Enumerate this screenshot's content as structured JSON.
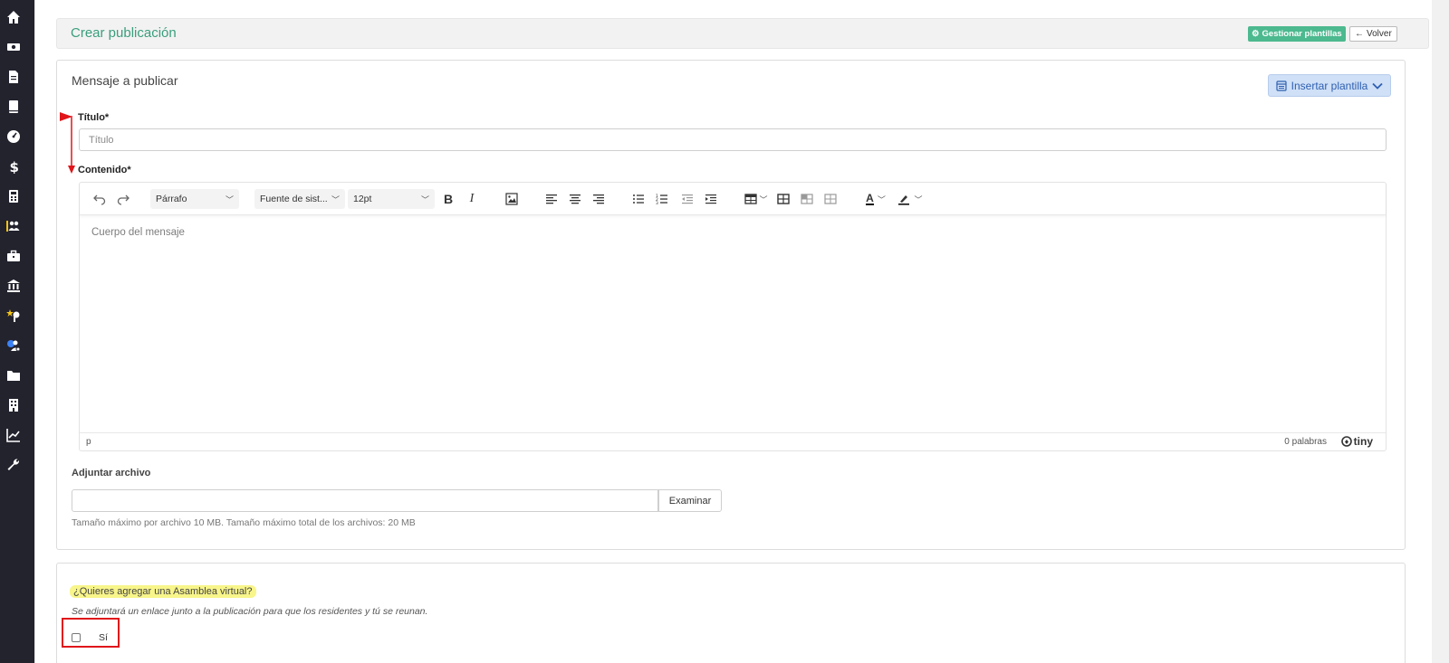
{
  "sidebar": {
    "icons": [
      "home-icon",
      "money-icon",
      "document-icon",
      "book-icon",
      "dashboard-icon",
      "dollar-icon",
      "calculator-icon",
      "users-icon",
      "briefcase-icon",
      "bank-icon",
      "key-star-icon",
      "users-settings-icon",
      "folder-icon",
      "building-icon",
      "chart-icon",
      "wrench-icon"
    ]
  },
  "header": {
    "title": "Crear publicación",
    "templates_button": "Gestionar plantillas",
    "back_button": "Volver"
  },
  "message": {
    "section_title": "Mensaje a publicar",
    "insert_template_button": "Insertar plantilla",
    "title_label": "Título*",
    "title_placeholder": "Título",
    "content_label": "Contenido*",
    "editor": {
      "block_format": "Párrafo",
      "font_family": "Fuente de sist...",
      "font_size": "12pt",
      "body_placeholder": "Cuerpo del mensaje",
      "status_path": "p",
      "word_count": "0 palabras",
      "brand": "tiny"
    },
    "attach_label": "Adjuntar archivo",
    "browse_button": "Examinar",
    "help_text": "Tamaño máximo por archivo 10 MB. Tamaño máximo total de los archivos: 20 MB"
  },
  "assembly": {
    "question": "¿Quieres agregar una Asamblea virtual?",
    "description": "Se adjuntará un enlace junto a la publicación para que los residentes y tú se reunan.",
    "checkbox_label": "Sí",
    "checked": false
  },
  "colors": {
    "sidebar_bg": "#23232e",
    "title_green": "#3a9e7c",
    "button_green": "#4cb98f",
    "insert_blue": "#cfe0f7",
    "highlight_yellow": "#f8f58a",
    "annotation_red": "#e0161b"
  }
}
